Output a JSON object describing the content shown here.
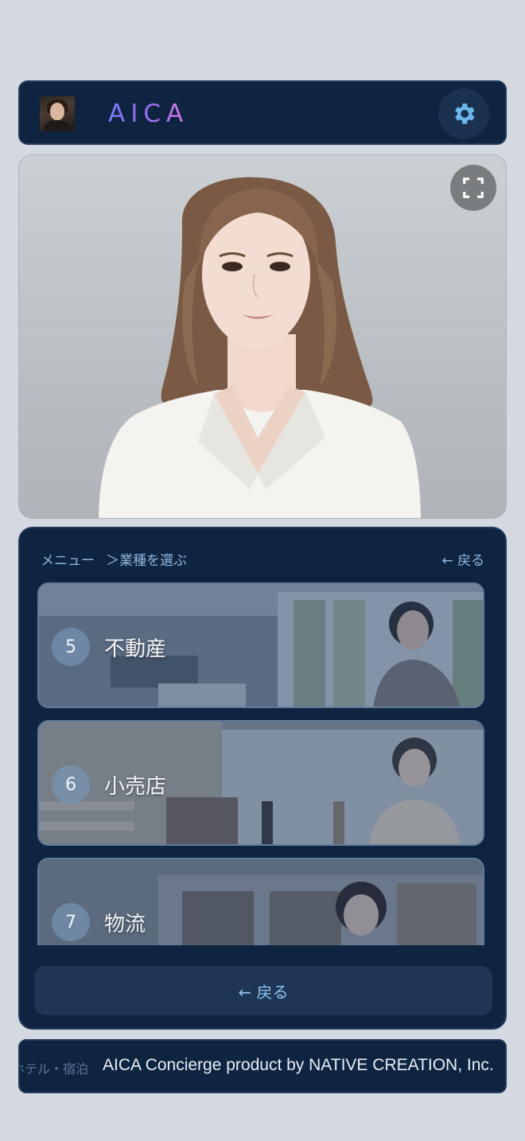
{
  "header": {
    "brand": "AICA",
    "settings_icon": "gear-icon"
  },
  "viewer": {
    "fullscreen_icon": "fullscreen-icon"
  },
  "menu": {
    "breadcrumb_root": "メニュー",
    "breadcrumb_current": "＞業種を選ぶ",
    "back_link": "← 戻る",
    "items": [
      {
        "number": "5",
        "label": "不動産"
      },
      {
        "number": "6",
        "label": "小売店"
      },
      {
        "number": "7",
        "label": "物流"
      }
    ],
    "back_button": "← 戻る"
  },
  "footer": {
    "ticker_prev": "ホテル・宿泊",
    "ticker_text": "AICA Concierge product by NATIVE CREATION, Inc."
  },
  "colors": {
    "panel": "#0f2440",
    "accent": "#8fc3f0",
    "background": "#d3d8e1"
  }
}
